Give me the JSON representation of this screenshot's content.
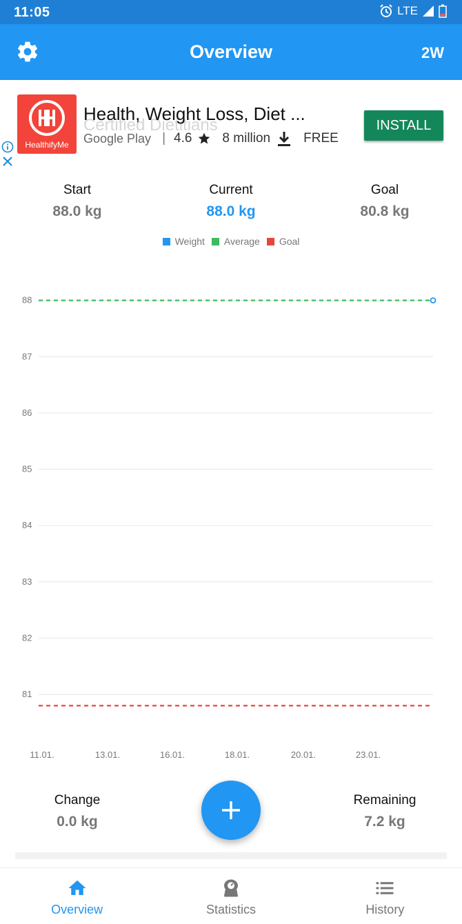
{
  "status_bar": {
    "time": "11:05",
    "network": "LTE"
  },
  "app_bar": {
    "title": "Overview",
    "range": "2W"
  },
  "ad": {
    "logo_text": "HealthifyMe",
    "title": "Health, Weight Loss, Diet ...",
    "ghost_text": "Certified Dietitians",
    "store": "Google Play",
    "separator": "|",
    "rating": "4.6",
    "downloads": "8 million",
    "price": "FREE",
    "install_label": "INSTALL"
  },
  "stats": {
    "start": {
      "label": "Start",
      "value": "88.0 kg"
    },
    "current": {
      "label": "Current",
      "value": "88.0 kg"
    },
    "goal": {
      "label": "Goal",
      "value": "80.8 kg"
    }
  },
  "legend": [
    {
      "name": "Weight",
      "color": "#2196f3"
    },
    {
      "name": "Average",
      "color": "#3dbb5e"
    },
    {
      "name": "Goal",
      "color": "#e8453c"
    }
  ],
  "chart_data": {
    "type": "line",
    "y_ticks": [
      "88",
      "87",
      "86",
      "85",
      "84",
      "83",
      "82",
      "81"
    ],
    "x_ticks": [
      "11.01.",
      "13.01.",
      "16.01.",
      "18.01.",
      "20.01.",
      "23.01."
    ],
    "series": [
      {
        "name": "Weight",
        "color": "#2196f3",
        "points": [
          {
            "x": "25.01.",
            "y": 88.0
          }
        ]
      },
      {
        "name": "Average",
        "color": "#3dbb5e",
        "y": 88.0,
        "style": "dashed"
      },
      {
        "name": "Goal",
        "color": "#e8453c",
        "y": 80.8,
        "style": "dashed"
      }
    ],
    "ylim": [
      80.4,
      88.4
    ],
    "grid": true
  },
  "bottom_stats": {
    "change": {
      "label": "Change",
      "value": "0.0 kg"
    },
    "remaining": {
      "label": "Remaining",
      "value": "7.2 kg"
    }
  },
  "bottom_nav": [
    {
      "label": "Overview",
      "active": true
    },
    {
      "label": "Statistics",
      "active": false
    },
    {
      "label": "History",
      "active": false
    }
  ]
}
